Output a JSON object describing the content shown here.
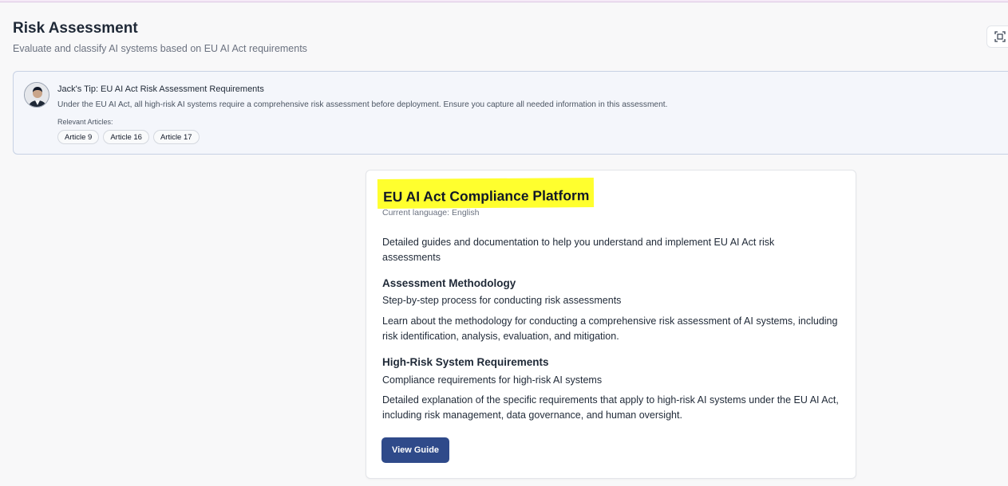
{
  "header": {
    "title": "Risk Assessment",
    "subtitle": "Evaluate and classify AI systems based on EU AI Act requirements",
    "corner_icon": "screenshot-scan-icon"
  },
  "tip": {
    "avatar_icon": "user-avatar",
    "title": "Jack's Tip: EU AI Act Risk Assessment Requirements",
    "text": "Under the EU AI Act, all high-risk AI systems require a comprehensive risk assessment before deployment. Ensure you capture all needed information in this assessment.",
    "articles_label": "Relevant Articles:",
    "articles": [
      "Article 9",
      "Article 16",
      "Article 17"
    ]
  },
  "card": {
    "title": "EU AI Act Compliance Platform",
    "language": "Current language: English",
    "intro": "Detailed guides and documentation to help you understand and implement EU AI Act risk assessments",
    "sections": [
      {
        "heading": "Assessment Methodology",
        "subheading": "Step-by-step process for conducting risk assessments",
        "body": "Learn about the methodology for conducting a comprehensive risk assessment of AI systems, including risk identification, analysis, evaluation, and mitigation."
      },
      {
        "heading": "High-Risk System Requirements",
        "subheading": "Compliance requirements for high-risk AI systems",
        "body": "Detailed explanation of the specific requirements that apply to high-risk AI systems under the EU AI Act, including risk management, data governance, and human oversight."
      }
    ],
    "button_label": "View Guide"
  },
  "colors": {
    "highlight": "#ffff2e",
    "primary_button": "#2f4a8a",
    "tip_background": "#f4f6fb"
  }
}
